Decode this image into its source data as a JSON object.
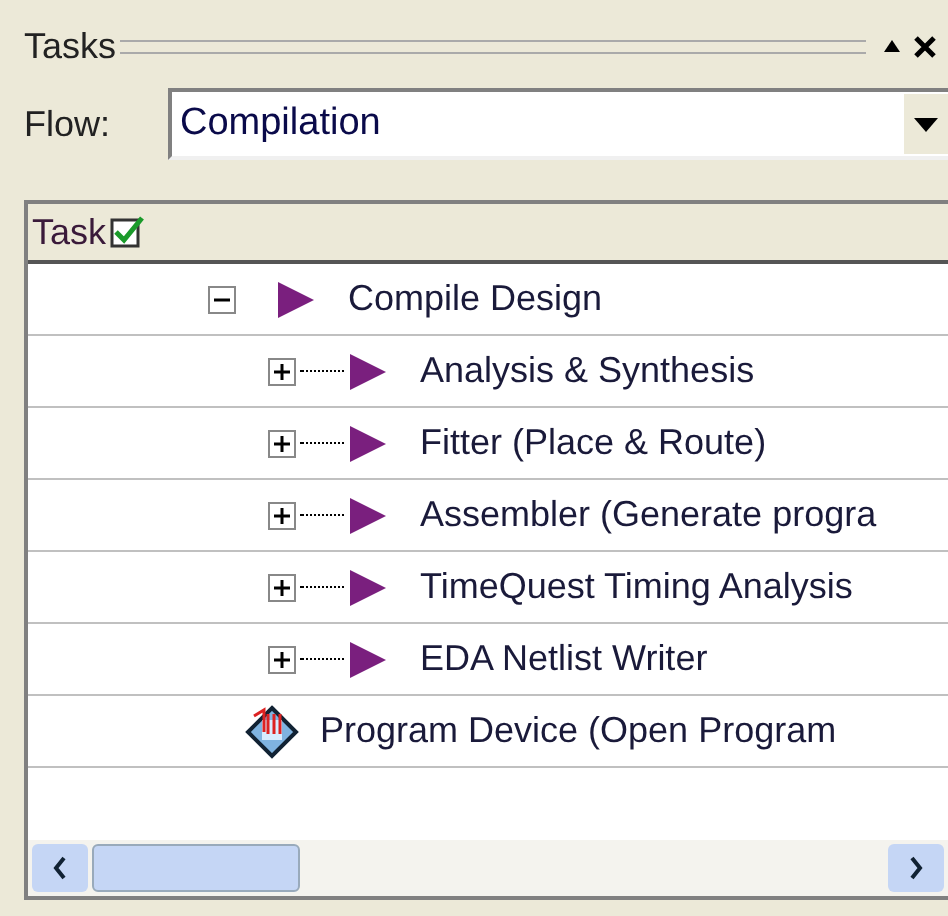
{
  "panel": {
    "title": "Tasks"
  },
  "flow": {
    "label": "Flow:",
    "value": "Compilation"
  },
  "table": {
    "columns": [
      "Task"
    ],
    "rows": [
      {
        "kind": "task",
        "label": "Compile Design",
        "expanded": true,
        "children": [
          {
            "kind": "task",
            "label": "Analysis & Synthesis",
            "expanded": false
          },
          {
            "kind": "task",
            "label": "Fitter (Place & Route)",
            "expanded": false
          },
          {
            "kind": "task",
            "label": "Assembler (Generate progra",
            "expanded": false
          },
          {
            "kind": "task",
            "label": "TimeQuest Timing Analysis",
            "expanded": false
          },
          {
            "kind": "task",
            "label": "EDA Netlist Writer",
            "expanded": false
          }
        ]
      },
      {
        "kind": "program",
        "label": "Program Device (Open Program"
      }
    ]
  }
}
